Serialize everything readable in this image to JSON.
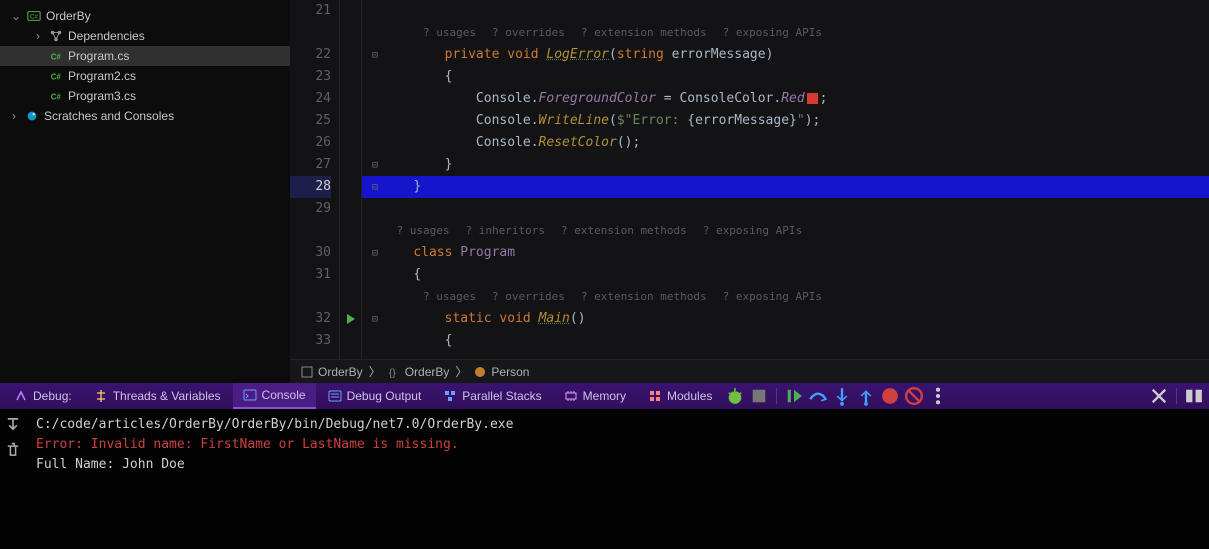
{
  "sidebar": {
    "project": "OrderBy",
    "items": [
      {
        "label": "Dependencies",
        "icon": "deps"
      },
      {
        "label": "Program.cs",
        "icon": "cs",
        "selected": true
      },
      {
        "label": "Program2.cs",
        "icon": "cs"
      },
      {
        "label": "Program3.cs",
        "icon": "cs"
      }
    ],
    "scratches": "Scratches and Consoles"
  },
  "code_hints": {
    "usages": "? usages",
    "overrides": "? overrides",
    "extmethods": "? extension methods",
    "exposing": "? exposing APIs",
    "inheritors": "? inheritors"
  },
  "code": {
    "lines": [
      {
        "n": 21,
        "type": "blank"
      },
      {
        "type": "hints",
        "set": [
          "usages",
          "overrides",
          "extmethods",
          "exposing"
        ],
        "indent": "        "
      },
      {
        "n": 22,
        "type": "code",
        "html": "        <span class='kw'>private</span> <span class='kw'>void</span> <span class='mth-u'>LogError</span><span class='punc'>(</span><span class='kw'>string</span> <span class='ident'>errorMessage</span><span class='punc'>)</span>",
        "fold": "open"
      },
      {
        "n": 23,
        "type": "code",
        "html": "        <span class='punc'>{</span>"
      },
      {
        "n": 24,
        "type": "code",
        "html": "            <span class='ident'>Console</span><span class='punc'>.</span><span class='enum'>ForegroundColor</span> <span class='punc'>=</span> <span class='ident'>ConsoleColor</span><span class='punc'>.</span><span class='enum'>Red</span><span class='redbox'></span><span class='punc'>;</span>"
      },
      {
        "n": 25,
        "type": "code",
        "html": "            <span class='ident'>Console</span><span class='punc'>.</span><span class='mth'>WriteLine</span><span class='punc'>(</span><span class='str'>$\"Error: </span><span class='punc'>{</span><span class='ident'>errorMessage</span><span class='punc'>}</span><span class='str'>\"</span><span class='punc'>);</span>"
      },
      {
        "n": 26,
        "type": "code",
        "html": "            <span class='ident'>Console</span><span class='punc'>.</span><span class='mth'>ResetColor</span><span class='punc'>();</span>"
      },
      {
        "n": 27,
        "type": "code",
        "html": "        <span class='punc'>}</span>",
        "fold": "close"
      },
      {
        "n": 28,
        "type": "code",
        "html": "    <span class='punc'>}</span>",
        "hl": true,
        "fold": "close"
      },
      {
        "n": 29,
        "type": "blank"
      },
      {
        "type": "hints",
        "set": [
          "usages",
          "inheritors",
          "extmethods",
          "exposing"
        ],
        "indent": "    "
      },
      {
        "n": 30,
        "type": "code",
        "html": "    <span class='kw'>class</span> <span class='ty'>Program</span>",
        "fold": "open"
      },
      {
        "n": 31,
        "type": "code",
        "html": "    <span class='punc'>{</span>"
      },
      {
        "type": "hints",
        "set": [
          "usages",
          "overrides",
          "extmethods",
          "exposing"
        ],
        "indent": "        "
      },
      {
        "n": 32,
        "type": "code",
        "html": "        <span class='kw'>static</span> <span class='kw'>void</span> <span class='mth-u'>Main</span><span class='punc'>()</span>",
        "run": true,
        "fold": "open"
      },
      {
        "n": 33,
        "type": "code",
        "html": "        <span class='punc'>{</span>"
      }
    ]
  },
  "breadcrumb": {
    "items": [
      {
        "icon": "struct",
        "label": "OrderBy"
      },
      {
        "icon": "ns",
        "label": "OrderBy"
      },
      {
        "icon": "class",
        "label": "Person"
      }
    ]
  },
  "debug": {
    "label": "Debug:",
    "tabs": [
      {
        "icon": "threads",
        "label": "Threads & Variables"
      },
      {
        "icon": "console",
        "label": "Console",
        "active": true
      },
      {
        "icon": "output",
        "label": "Debug Output"
      },
      {
        "icon": "stacks",
        "label": "Parallel Stacks"
      },
      {
        "icon": "memory",
        "label": "Memory"
      },
      {
        "icon": "modules",
        "label": "Modules"
      }
    ]
  },
  "console": {
    "lines": [
      {
        "cls": "norm",
        "text": "C:/code/articles/OrderBy/OrderBy/bin/Debug/net7.0/OrderBy.exe"
      },
      {
        "cls": "err",
        "text": "Error: Invalid name: FirstName or LastName is missing."
      },
      {
        "cls": "norm",
        "text": "Full Name: John Doe"
      }
    ]
  }
}
